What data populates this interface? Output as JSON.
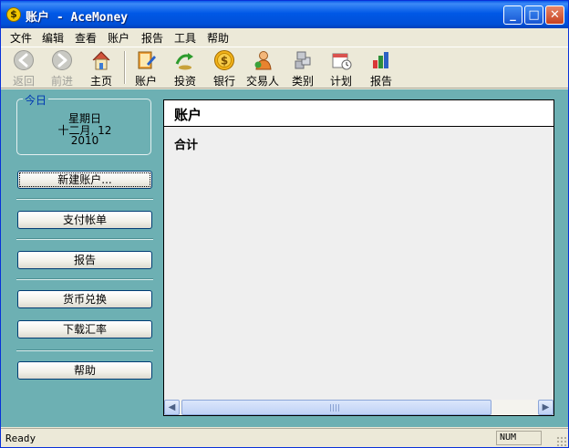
{
  "window": {
    "title": "账户 - AceMoney"
  },
  "menubar": {
    "items": [
      "文件",
      "编辑",
      "查看",
      "账户",
      "报告",
      "工具",
      "帮助"
    ]
  },
  "toolbar": {
    "back": "返回",
    "forward": "前进",
    "home": "主页",
    "accounts": "账户",
    "investments": "投资",
    "bank": "银行",
    "payees": "交易人",
    "categories": "类别",
    "schedule": "计划",
    "reports": "报告"
  },
  "today": {
    "legend": "今日",
    "weekday": "星期日",
    "date": "十二月, 12",
    "year": "2010"
  },
  "sidebar": {
    "new_account": "新建账户...",
    "pay_bills": "支付帐单",
    "reports": "报告",
    "currency_exchange": "货币兑换",
    "download_rates": "下载汇率",
    "help": "帮助"
  },
  "main": {
    "title": "账户",
    "total_label": "合计"
  },
  "status": {
    "text": "Ready",
    "num": "NUM"
  },
  "colors": {
    "workspace": "#6db0b3",
    "titlebar": "#0058e6",
    "legend": "#0039b3"
  }
}
